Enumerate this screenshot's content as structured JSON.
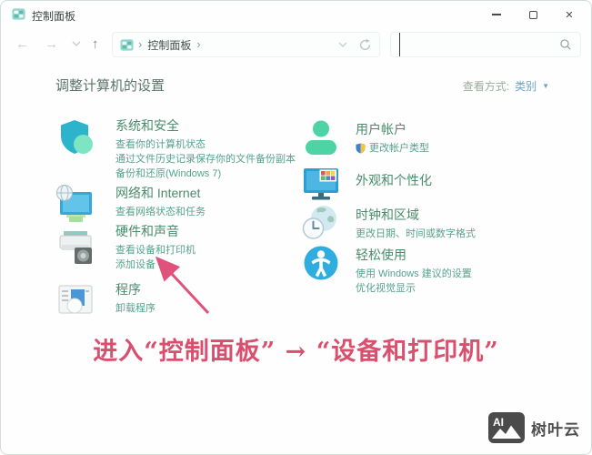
{
  "window": {
    "title": "控制面板"
  },
  "toolbar": {
    "breadcrumb_root": "控制面板",
    "search_value": ""
  },
  "page": {
    "heading": "调整计算机的设置",
    "view_by_label": "查看方式:",
    "view_by_value": "类别",
    "view_by_caret": "▼"
  },
  "categories": {
    "left": [
      {
        "icon": "shield-icon",
        "title": "系统和安全",
        "links": [
          "查看你的计算机状态",
          "通过文件历史记录保存你的文件备份副本",
          "备份和还原(Windows 7)"
        ]
      },
      {
        "icon": "network-icon",
        "title": "网络和 Internet",
        "links": [
          "查看网络状态和任务"
        ]
      },
      {
        "icon": "printer-icon",
        "title": "硬件和声音",
        "links": [
          "查看设备和打印机",
          "添加设备"
        ]
      },
      {
        "icon": "programs-icon",
        "title": "程序",
        "links": [
          "卸载程序"
        ]
      }
    ],
    "right": [
      {
        "icon": "user-icon",
        "title": "用户帐户",
        "links": [
          "更改帐户类型"
        ]
      },
      {
        "icon": "personalization-icon",
        "title": "外观和个性化",
        "links": []
      },
      {
        "icon": "clock-icon",
        "title": "时钟和区域",
        "links": [
          "更改日期、时间或数字格式"
        ]
      },
      {
        "icon": "ease-icon",
        "title": "轻松使用",
        "links": [
          "使用 Windows 建议的设置",
          "优化视觉显示"
        ]
      }
    ]
  },
  "annotation": {
    "text": "进入“控制面板” → “设备和打印机”",
    "text_color": "#d8506e",
    "arrow_color": "#e0527a"
  },
  "watermark": {
    "logo_text": "AI",
    "brand": "树叶云"
  },
  "colors": {
    "category_title": "#4b8b6d",
    "category_link": "#57a28d",
    "view_by_value": "#6fa3c5"
  }
}
